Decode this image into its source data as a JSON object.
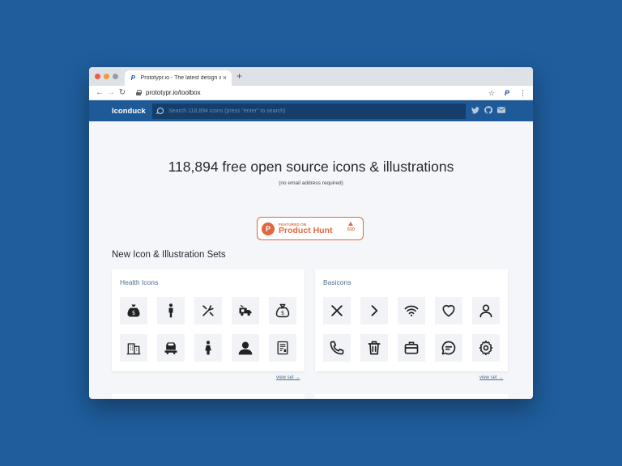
{
  "browser": {
    "tab_title": "Prototypr.io - The latest design and",
    "tab_close": "×",
    "new_tab": "+",
    "url": "prototypr.io/toolbox",
    "back": "←",
    "forward": "→",
    "reload": "↻",
    "star": "☆",
    "extension": "P",
    "menu": "⋮"
  },
  "site": {
    "logo": "Iconduck",
    "search_placeholder": "Search 118,894 icons (press \"enter\" to search)",
    "social_icons": [
      "twitter-icon",
      "github-icon",
      "mail-icon"
    ]
  },
  "hero": {
    "title": "118,894 free open source icons & illustrations",
    "subtitle": "(no email address required)"
  },
  "product_hunt": {
    "featured": "FEATURED ON",
    "name": "Product Hunt",
    "logo_letter": "P",
    "votes": "510"
  },
  "sets": {
    "heading": "New Icon & Illustration Sets",
    "cards": [
      {
        "title": "Health Icons",
        "link": "view set →",
        "icons": [
          "money-bag-icon",
          "person-icon",
          "medicine-icon",
          "ambulance-icon",
          "money-bag-icon",
          "hospital-building-icon",
          "vehicle-icon",
          "woman-icon",
          "user-icon",
          "prescription-icon"
        ]
      },
      {
        "title": "Basicons",
        "link": "view set →",
        "icons": [
          "close-icon",
          "chevron-right-icon",
          "wifi-icon",
          "heart-icon",
          "user-icon",
          "phone-icon",
          "trash-icon",
          "briefcase-icon",
          "chat-icon",
          "gear-icon"
        ]
      }
    ]
  },
  "colors": {
    "background": "#1f5d9c",
    "nav": "#1e5a97",
    "search": "#163e6b",
    "accent": "#e0683f"
  }
}
